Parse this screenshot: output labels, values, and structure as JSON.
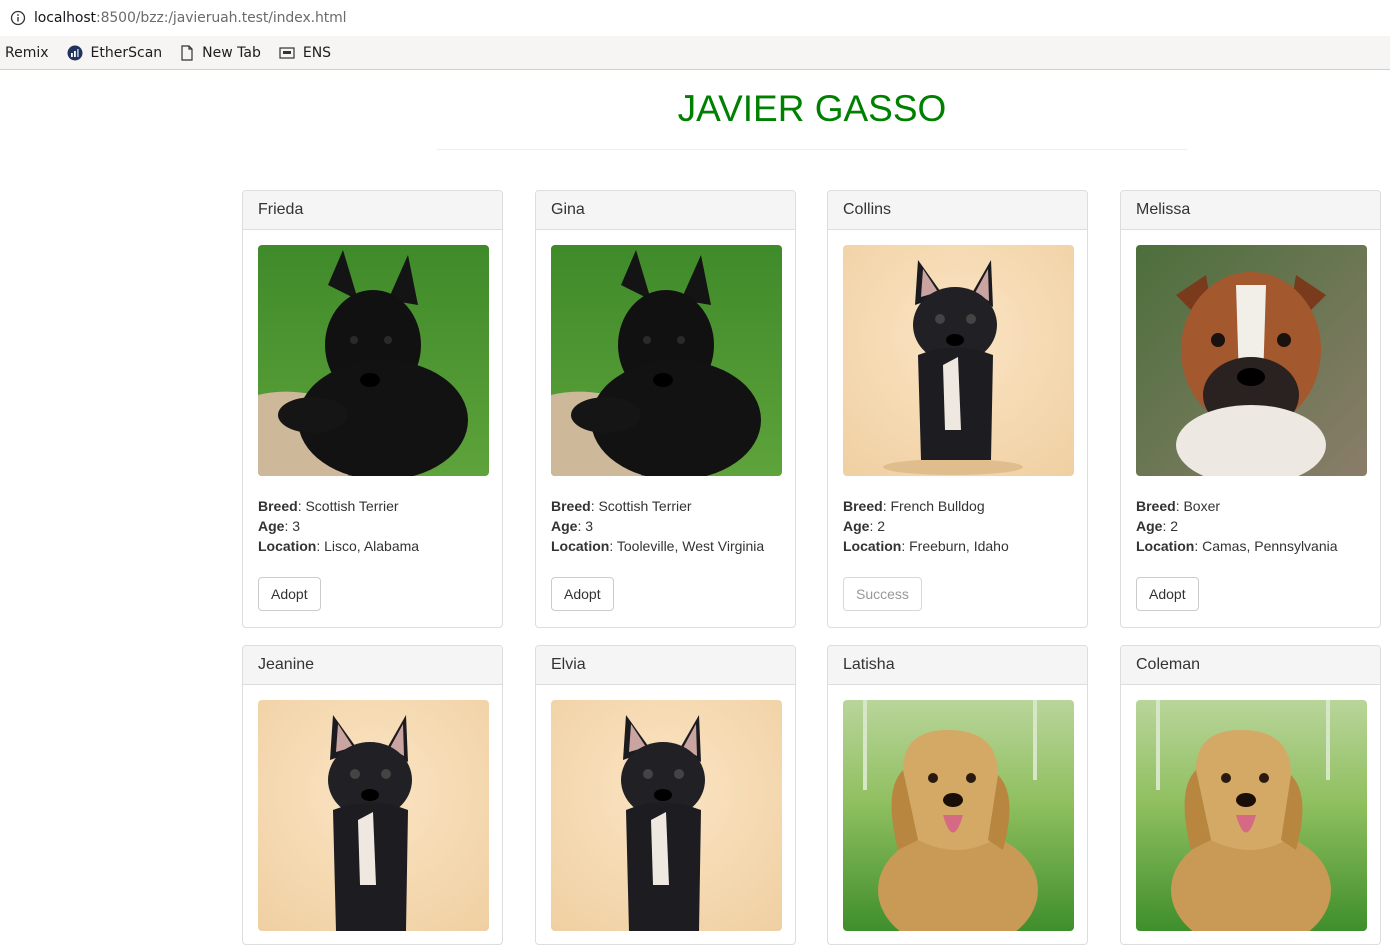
{
  "browser": {
    "url_host": "localhost",
    "url_rest": ":8500/bzz:/javieruah.test/index.html",
    "bookmarks": [
      {
        "label": "Remix",
        "icon": "none"
      },
      {
        "label": "EtherScan",
        "icon": "etherscan-icon"
      },
      {
        "label": "New Tab",
        "icon": "page-icon"
      },
      {
        "label": "ENS",
        "icon": "ens-icon"
      }
    ]
  },
  "page": {
    "title": "JAVIER GASSO"
  },
  "labels": {
    "breed": "Breed",
    "age": "Age",
    "location": "Location"
  },
  "pets": [
    {
      "name": "Frieda",
      "breed": "Scottish Terrier",
      "age": "3",
      "location": "Lisco, Alabama",
      "button": "Adopt",
      "adopted": false,
      "photo": "scottish-terrier"
    },
    {
      "name": "Gina",
      "breed": "Scottish Terrier",
      "age": "3",
      "location": "Tooleville, West Virginia",
      "button": "Adopt",
      "adopted": false,
      "photo": "scottish-terrier"
    },
    {
      "name": "Collins",
      "breed": "French Bulldog",
      "age": "2",
      "location": "Freeburn, Idaho",
      "button": "Success",
      "adopted": true,
      "photo": "french-bulldog"
    },
    {
      "name": "Melissa",
      "breed": "Boxer",
      "age": "2",
      "location": "Camas, Pennsylvania",
      "button": "Adopt",
      "adopted": false,
      "photo": "boxer"
    },
    {
      "name": "Jeanine",
      "photo": "french-bulldog"
    },
    {
      "name": "Elvia",
      "photo": "french-bulldog"
    },
    {
      "name": "Latisha",
      "photo": "golden-retriever"
    },
    {
      "name": "Coleman",
      "photo": "golden-retriever"
    }
  ],
  "colors": {
    "title": "#008000",
    "card_border": "#dddddd",
    "card_head": "#f5f5f5"
  }
}
